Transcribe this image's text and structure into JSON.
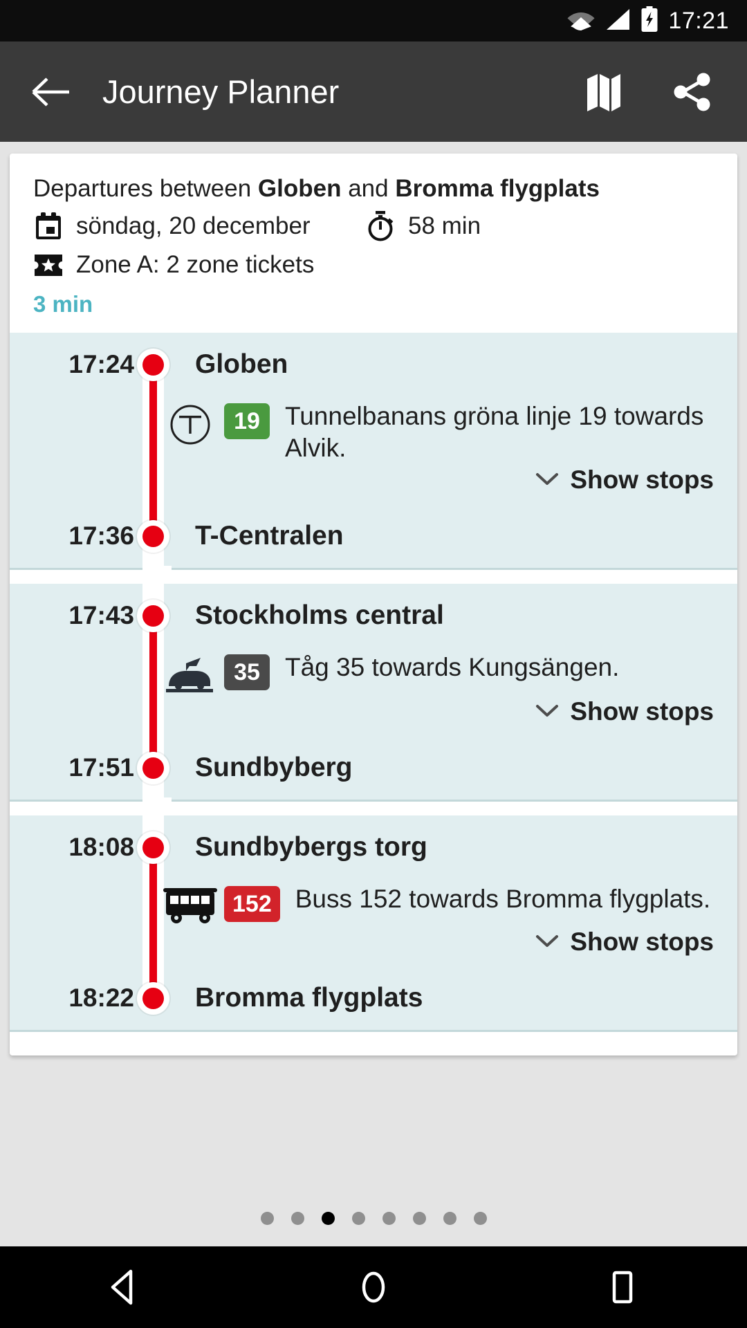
{
  "status_bar": {
    "time": "17:21",
    "icons": [
      "wifi-icon",
      "signal-icon",
      "battery-charging-icon"
    ]
  },
  "app_bar": {
    "back_icon": "back-arrow-icon",
    "title": "Journey Planner",
    "map_icon": "map-icon",
    "share_icon": "share-icon"
  },
  "journey": {
    "summary_prefix": "Departures between ",
    "origin": "Globen",
    "summary_middle": " and ",
    "destination": "Bromma flygplats",
    "date_icon": "calendar-icon",
    "date": "söndag, 20 december",
    "duration_icon": "stopwatch-icon",
    "duration": "58 min",
    "ticket_icon": "ticket-star-icon",
    "ticket": "Zone A: 2 zone tickets",
    "wait_time": "3 min"
  },
  "segments": [
    {
      "depart_time": "17:24",
      "depart_stop": "Globen",
      "mode_icon": "metro-icon",
      "line": "19",
      "line_color": "#4a9a3f",
      "line_text_color": "#ffffff",
      "description": "Tunnelbanans gröna linje 19 towards Alvik.",
      "show_stops_label": "Show stops",
      "show_stops_icon": "chevron-down-icon",
      "arrive_time": "17:36",
      "arrive_stop": "T-Centralen"
    },
    {
      "depart_time": "17:43",
      "depart_stop": "Stockholms central",
      "mode_icon": "train-icon",
      "line": "35",
      "line_color": "#4a4a4a",
      "line_text_color": "#ffffff",
      "description": "Tåg 35 towards Kungsängen.",
      "show_stops_label": "Show stops",
      "show_stops_icon": "chevron-down-icon",
      "arrive_time": "17:51",
      "arrive_stop": "Sundbyberg"
    },
    {
      "depart_time": "18:08",
      "depart_stop": "Sundbybergs torg",
      "mode_icon": "bus-icon",
      "line": "152",
      "line_color": "#d2232a",
      "line_text_color": "#ffffff",
      "description": "Buss 152 towards Bromma flygplats.",
      "show_stops_label": "Show stops",
      "show_stops_icon": "chevron-down-icon",
      "arrive_time": "18:22",
      "arrive_stop": "Bromma flygplats"
    }
  ],
  "pager": {
    "count": 8,
    "active_index": 2
  },
  "nav_bar": {
    "back_icon": "nav-back-icon",
    "home_icon": "nav-home-icon",
    "recents_icon": "nav-recents-icon"
  },
  "colors": {
    "accent_teal": "#4cb4c2",
    "rail_red": "#e60012",
    "segment_bg": "#e1eef0",
    "page_bg": "#e4e4e4",
    "appbar_bg": "#3a3a3a"
  }
}
